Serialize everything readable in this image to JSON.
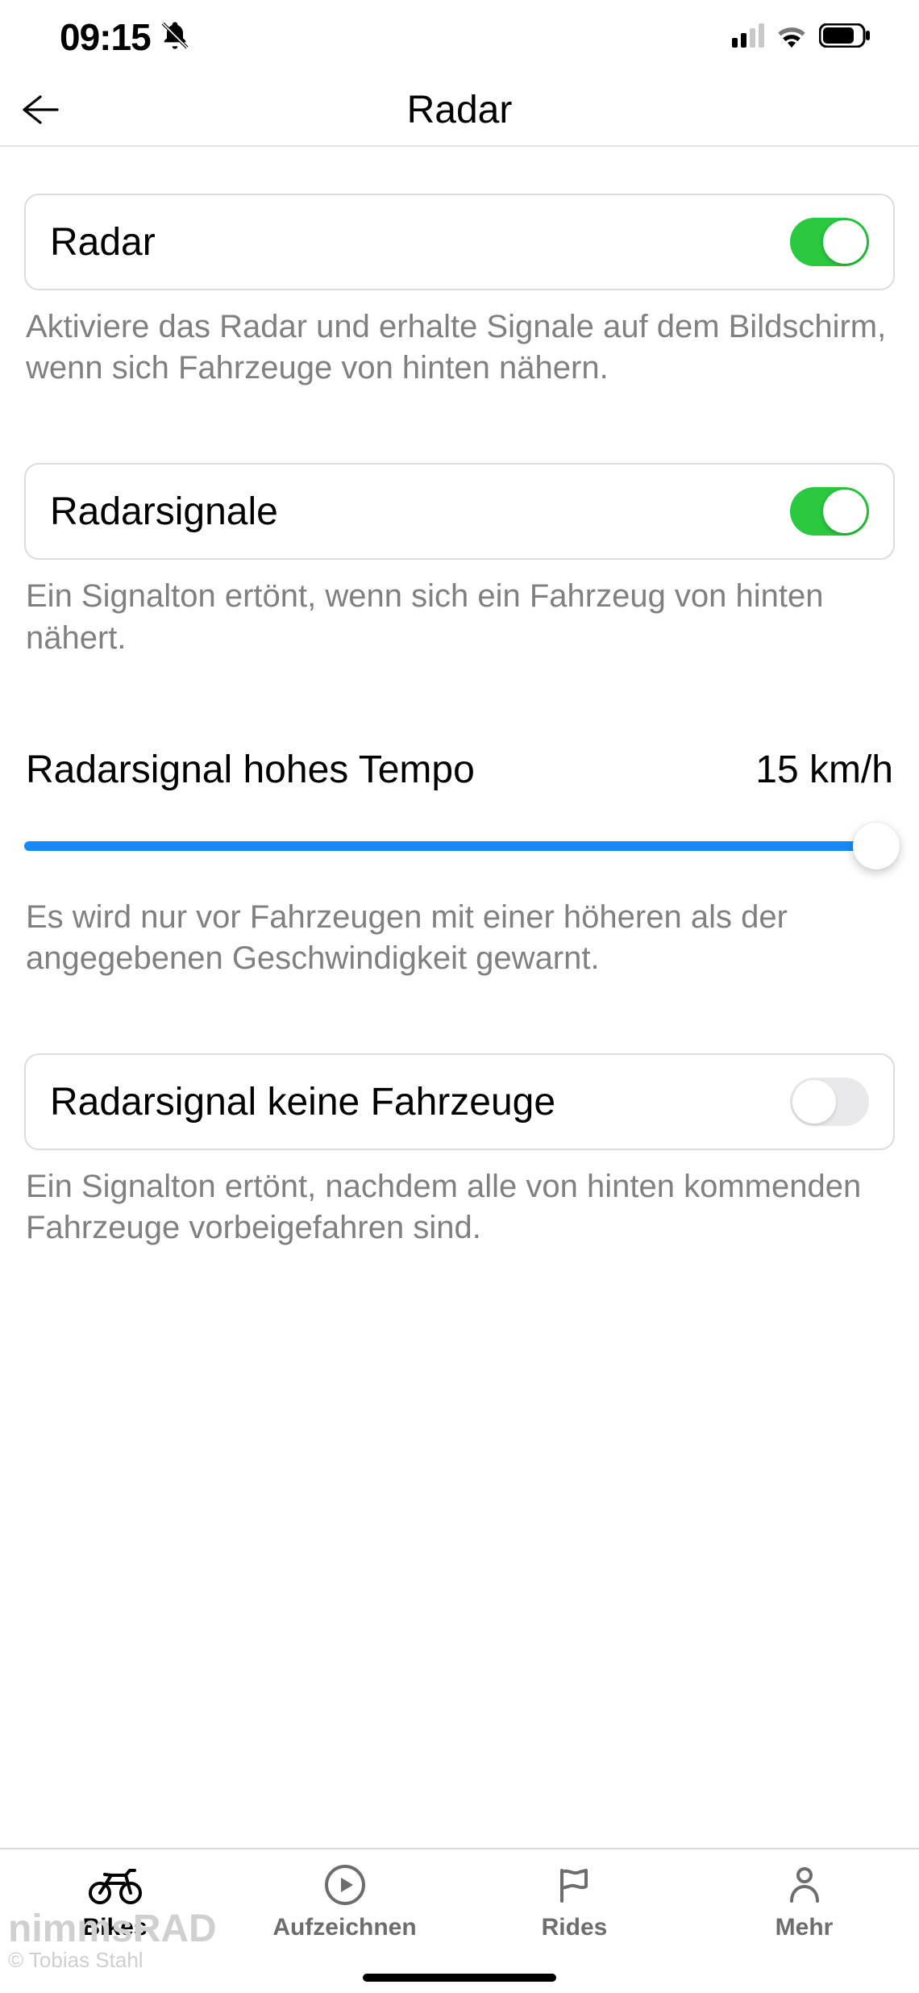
{
  "status": {
    "time": "09:15"
  },
  "nav": {
    "title": "Radar"
  },
  "settings": {
    "radar": {
      "label": "Radar",
      "on": true,
      "desc": "Aktiviere das Radar und erhalte Signale auf dem Bildschirm, wenn sich Fahrzeuge von hinten nähern."
    },
    "signals": {
      "label": "Radarsignale",
      "on": true,
      "desc": "Ein Signalton ertönt, wenn sich ein Fahrzeug von hinten nähert."
    },
    "speed": {
      "label": "Radarsignal hohes Tempo",
      "value": "15 km/h",
      "desc": "Es wird nur vor Fahrzeugen mit einer höheren als der angegebenen Geschwindigkeit gewarnt."
    },
    "noVehicles": {
      "label": "Radarsignal keine Fahrzeuge",
      "on": false,
      "desc": "Ein Signalton ertönt, nachdem alle von hinten kommenden Fahrzeuge vorbeigefahren sind."
    }
  },
  "tabs": {
    "bikes": {
      "label": "Bikes"
    },
    "record": {
      "label": "Aufzeichnen"
    },
    "rides": {
      "label": "Rides"
    },
    "more": {
      "label": "Mehr"
    }
  },
  "watermark": {
    "line1": "nimmsRAD",
    "line2": "© Tobias Stahl"
  }
}
